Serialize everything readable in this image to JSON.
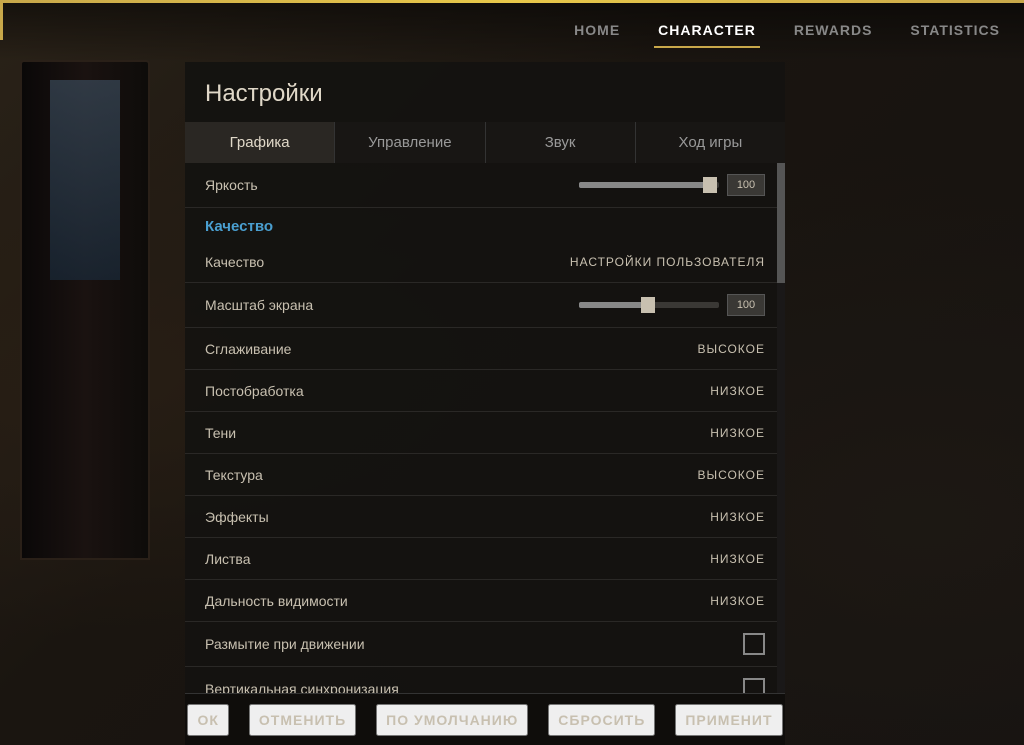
{
  "nav": {
    "tabs": [
      {
        "id": "home",
        "label": "HOME",
        "active": false
      },
      {
        "id": "character",
        "label": "CHARACTER",
        "active": false
      },
      {
        "id": "rewards",
        "label": "REWARDS",
        "active": false
      },
      {
        "id": "statistics",
        "label": "STATISTICS",
        "active": false
      }
    ]
  },
  "panel": {
    "title": "Настройки",
    "tabs": [
      {
        "id": "graphics",
        "label": "Графика",
        "active": true
      },
      {
        "id": "controls",
        "label": "Управление",
        "active": false
      },
      {
        "id": "sound",
        "label": "Звук",
        "active": false
      },
      {
        "id": "gameplay",
        "label": "Ход игры",
        "active": false
      }
    ]
  },
  "settings": {
    "brightness_label": "Яркость",
    "brightness_value": "100",
    "quality_section": "Качество",
    "rows": [
      {
        "id": "quality",
        "label": "Качество",
        "value": "НАСТРОЙКИ ПОЛЬЗОВАТЕЛЯ",
        "type": "text"
      },
      {
        "id": "scale",
        "label": "Масштаб экрана",
        "value": "100",
        "type": "slider_mid"
      },
      {
        "id": "aa",
        "label": "Сглаживание",
        "value": "ВЫСОКОЕ",
        "type": "text"
      },
      {
        "id": "postprocess",
        "label": "Постобработка",
        "value": "НИЗКОЕ",
        "type": "text"
      },
      {
        "id": "shadows",
        "label": "Тени",
        "value": "НИЗКОЕ",
        "type": "text"
      },
      {
        "id": "texture",
        "label": "Текстура",
        "value": "ВЫСОКОЕ",
        "type": "text"
      },
      {
        "id": "effects",
        "label": "Эффекты",
        "value": "НИЗКОЕ",
        "type": "text"
      },
      {
        "id": "foliage",
        "label": "Листва",
        "value": "НИЗКОЕ",
        "type": "text"
      },
      {
        "id": "viewdist",
        "label": "Дальность видимости",
        "value": "НИЗКОЕ",
        "type": "text"
      },
      {
        "id": "motionblur",
        "label": "Размытие при движении",
        "value": "",
        "type": "checkbox"
      },
      {
        "id": "vsync",
        "label": "Вертикальная синхронизация",
        "value": "",
        "type": "checkbox"
      }
    ]
  },
  "actions": [
    {
      "id": "ok",
      "label": "ОК"
    },
    {
      "id": "cancel",
      "label": "ОТМЕНИТЬ"
    },
    {
      "id": "default",
      "label": "ПО УМОЛЧАНИЮ"
    },
    {
      "id": "reset",
      "label": "СБРОСИТЬ"
    },
    {
      "id": "apply",
      "label": "ПРИМЕНИТ"
    }
  ]
}
